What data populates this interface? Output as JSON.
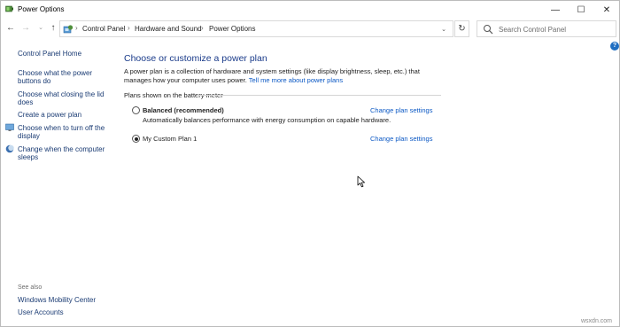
{
  "window": {
    "title": "Power Options",
    "min_glyph": "—",
    "max_glyph": "☐",
    "close_glyph": "✕"
  },
  "nav": {
    "back": "←",
    "forward": "→",
    "history": "⌄",
    "up": "↑",
    "breadcrumbs": [
      "Control Panel",
      "Hardware and Sound",
      "Power Options"
    ],
    "separator": "›",
    "dropdown": "⌄",
    "refresh": "↻",
    "search_placeholder": "Search Control Panel"
  },
  "help_glyph": "?",
  "left_pane": {
    "home": "Control Panel Home",
    "links": [
      "Choose what the power buttons do",
      "Choose what closing the lid does",
      "Create a power plan",
      "Choose when to turn off the display",
      "Change when the computer sleeps"
    ],
    "see_also_label": "See also",
    "see_also": [
      "Windows Mobility Center",
      "User Accounts"
    ]
  },
  "main": {
    "heading": "Choose or customize a power plan",
    "description": "A power plan is a collection of hardware and system settings (like display brightness, sleep, etc.) that manages how your computer uses power.",
    "description_link": "Tell me more about power plans",
    "group_title": "Plans shown on the battery meter",
    "plans": [
      {
        "name": "Balanced (recommended)",
        "description": "Automatically balances performance with energy consumption on capable hardware.",
        "link": "Change plan settings",
        "selected": false
      },
      {
        "name": "My Custom Plan 1",
        "description": "",
        "link": "Change plan settings",
        "selected": true
      }
    ]
  },
  "watermark": "wsxdn.com",
  "colors": {
    "link": "#0b58c4",
    "heading": "#1a3b8a",
    "help_badge": "#1f6ec1"
  }
}
